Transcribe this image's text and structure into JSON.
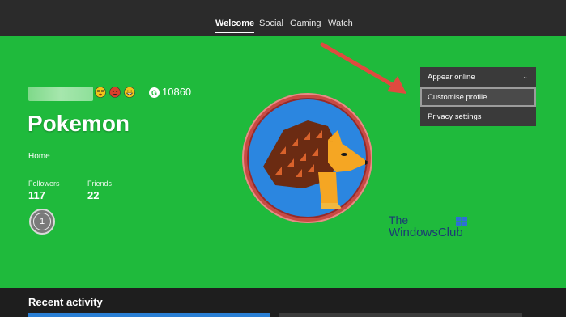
{
  "nav": {
    "tabs": [
      {
        "label": "Welcome",
        "active": true
      },
      {
        "label": "Social",
        "active": false
      },
      {
        "label": "Gaming",
        "active": false
      },
      {
        "label": "Watch",
        "active": false
      }
    ]
  },
  "profile": {
    "gamerscore_icon": "G",
    "gamerscore": "10860",
    "gamertag": "Pokemon",
    "location": "Home",
    "followers_label": "Followers",
    "followers_value": "117",
    "friends_label": "Friends",
    "friends_value": "22",
    "reputation_level": "1",
    "avatar": "hedgehog-gamerpic",
    "badges": [
      "face-icon",
      "angry-face-icon",
      "grinning-face-icon"
    ]
  },
  "menu": {
    "items": [
      {
        "label": "Appear online",
        "has_chevron": true
      },
      {
        "label": "Customise profile",
        "highlighted": true
      },
      {
        "label": "Privacy settings"
      }
    ],
    "chevron": "⌄"
  },
  "watermark": {
    "line1": "The",
    "line2": "WindowsClub"
  },
  "section": {
    "recent_activity": "Recent activity"
  },
  "colors": {
    "accent_green": "#1fba3c",
    "topbar": "#2b2b2b",
    "menu_bg": "#3a3a3a",
    "arrow": "#e04a3f",
    "avatar_ring": "#c94a43",
    "avatar_bg": "#2b86e0"
  }
}
